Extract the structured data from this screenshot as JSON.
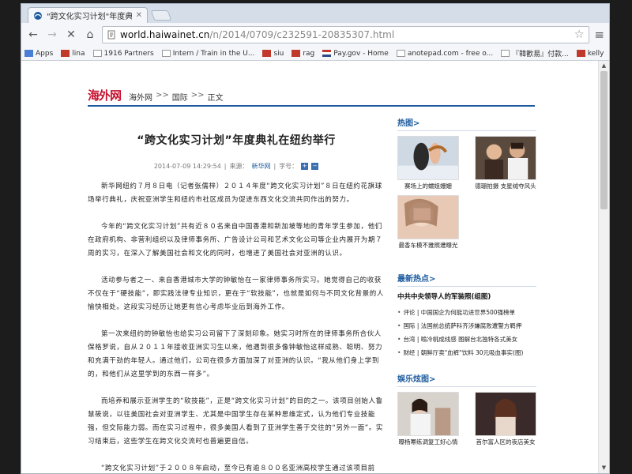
{
  "tab": {
    "title": "\"跨文化实习计划\"年度典礼在...",
    "close": "✕"
  },
  "address": {
    "host": "world.haiwainet.cn",
    "path": "/n/2014/0709/c232591-20835307.html"
  },
  "bookmarks": [
    {
      "label": "Apps",
      "icon": "apps-grid-icon"
    },
    {
      "label": "lina",
      "icon": "flag-icon"
    },
    {
      "label": "1916 Partners",
      "icon": "page-icon"
    },
    {
      "label": "Intern / Train in the U...",
      "icon": "page-icon"
    },
    {
      "label": "siu",
      "icon": "flag-icon"
    },
    {
      "label": "rag",
      "icon": "flag-icon"
    },
    {
      "label": "Pay.gov - Home",
      "icon": "us-flag-icon"
    },
    {
      "label": "anotepad.com - free o...",
      "icon": "page-icon"
    },
    {
      "label": "『韓歡易』付款...",
      "icon": "page-icon"
    },
    {
      "label": "kelly",
      "icon": "flag-icon"
    }
  ],
  "site": {
    "logo": "海外网",
    "crumbs": [
      "海外网",
      "国际",
      "正文"
    ],
    "crumb_sep": ">>"
  },
  "article": {
    "title": "“跨文化实习计划”年度典礼在纽约举行",
    "meta": {
      "date": "2014-07-09 14:29:54",
      "sep1": "|",
      "source_label": "来源：",
      "source": "新华网",
      "sep2": "|",
      "fontsize_label": "字号：",
      "plus": "+",
      "minus": "−"
    },
    "paragraphs": [
      "新华网纽约７月８日电（记者张儒梓）２０１４年度“跨文化实习计划”８日在纽约花旗球场举行典礼，庆祝亚洲学生和纽约市社区成员为促进东西文化交流共同作出的努力。",
      "今年的“跨文化实习计划”共有近８０名来自中国香港和新加坡等地的青年学生参加，他们在政府机构、非营利组织以及律师事务所、广告设计公司和艺术文化公司等企业内展开为期７周的实习，在深入了解美国社会和文化的同时，也增进了美国社会对亚洲的认识。",
      "活动参与者之一、来自香港城市大学的钟敏怡在一家律师事务所实习。她觉得自己的收获不仅在于“硬技能”，即实践法律专业知识，更在于“软技能”，也就是如何与不同文化背景的人愉快相处。这段实习经历让她更有信心考虑毕业后到海外工作。",
      "第一次来纽约的钟敏怡也给实习公司留下了深刻印象。她实习时所在的律师事务所合伙人保格罗说，自从２０１１年接收亚洲实习生以来，他遇到很多像钟敏怡这样成熟、聪明、努力和充满干劲的年轻人。通过他们，公司在很多方面加深了对亚洲的认识。“我从他们身上学到的，和他们从这里学到的东西一样多”。",
      "而培养和展示亚洲学生的“软技能”，正是“跨文化实习计划”的目的之一。该项目创始人鲁慧筱说，以往美国社会对亚洲学生、尤其是中国学生存在某种思维定式，认为他们专业技能强，但交际能力弱。而在实习过程中，很多美国人看到了亚洲学生善于交往的“另外一面”。实习结束后，这些学生在跨文化交流时也普遍更自信。",
      "“跨文化实习计划”于２００８年启动，至今已有逾８００名亚洲高校学生通过该项目前"
    ]
  },
  "sidebar": {
    "hot_pics": {
      "title": "热图",
      "arrow": ">",
      "items": [
        {
          "caption": "赛场上的蠕姐姗姗"
        },
        {
          "caption": "德珊拍摄 支星绒夺风头"
        },
        {
          "caption": "最香车模不雅照遭曝光"
        }
      ]
    },
    "hot_news": {
      "title": "最新热点",
      "arrow": ">",
      "headline": "中共中央领导人的军装照(组图)",
      "items": [
        {
          "tag": "评论",
          "text": "中国国企为何能功进世界500强榜单"
        },
        {
          "tag": "国际",
          "text": "法国前总统萨科齐涉嫌腐败遭警方羁押"
        },
        {
          "tag": "台湾",
          "text": "喻冷桃成线感  图解台北独特各式美女"
        },
        {
          "tag": "财经",
          "text": "朝鲜厅卖\"血裤\"饮料 30元吸血事实(图)"
        }
      ]
    },
    "ent_pics": {
      "title": "娱乐炫图",
      "arrow": ">",
      "items": [
        {
          "caption": "曝杨幂练调复工好心情"
        },
        {
          "caption": "首尔富人区的夜店美女"
        }
      ]
    }
  },
  "colors": {
    "link_blue": "#1d5b9e",
    "logo_red": "#c8102e"
  }
}
